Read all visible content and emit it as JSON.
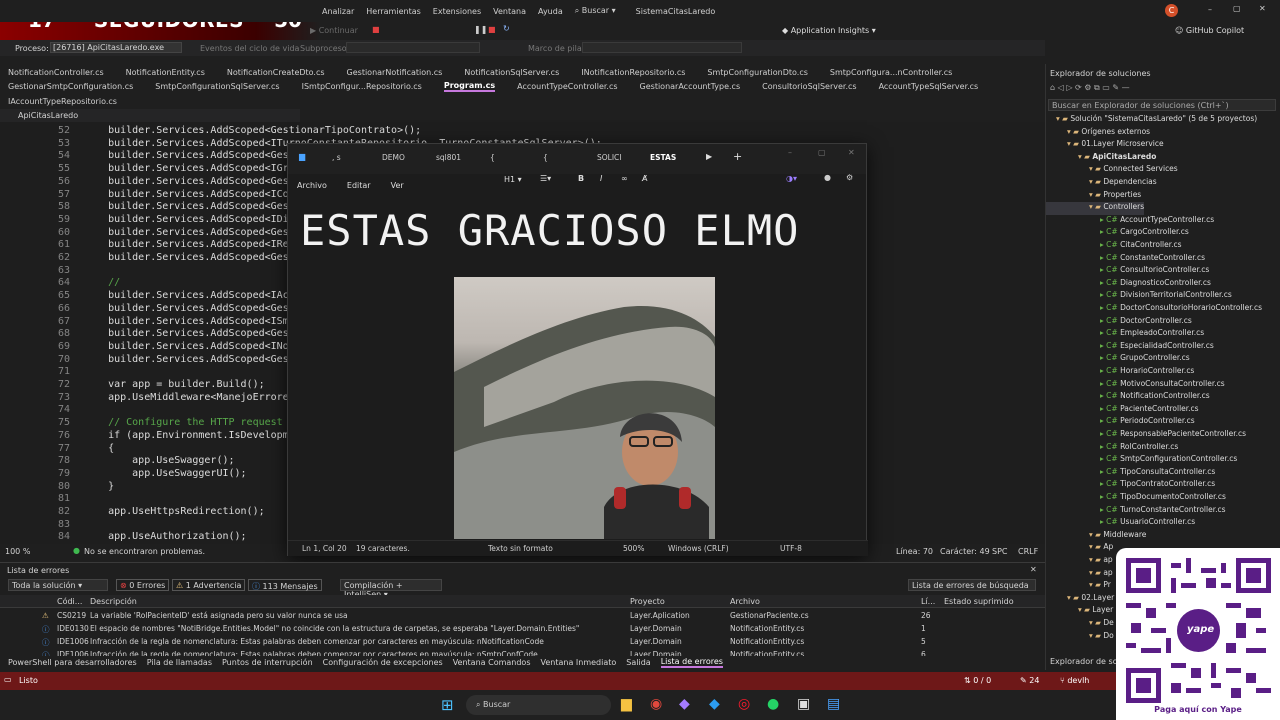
{
  "stream": {
    "count_left": "17",
    "label": "SEGUIDORES",
    "count_right": "50"
  },
  "menubar": {
    "items": [
      "Analizar",
      "Herramientas",
      "Extensiones",
      "Ventana",
      "Ayuda"
    ],
    "search": "Buscar",
    "solution_title": "SistemaCitasLaredo",
    "account_initial": "C"
  },
  "toolbar": {
    "continue": "Continuar",
    "app_insights": "Application Insights",
    "copilot": "GitHub Copilot"
  },
  "process_bar": {
    "label": "Proceso:",
    "process": "[26716] ApiCitasLaredo.exe",
    "lifecycle": "Eventos del ciclo de vida",
    "subprocess": "Subproceso:",
    "stack": "Marco de pila:"
  },
  "doc_tabs_row1": [
    "NotificationController.cs",
    "NotificationEntity.cs",
    "NotificationCreateDto.cs",
    "GestionarNotification.cs",
    "NotificationSqlServer.cs",
    "INotificationRepositorio.cs",
    "SmtpConfigurationDto.cs",
    "SmtpConfigura...nController.cs"
  ],
  "doc_tabs_row2": [
    "GestionarSmtpConfiguration.cs",
    "SmtpConfigurationSqlServer.cs",
    "ISmtpConfigur...Repositorio.cs",
    "Program.cs",
    "AccountTypeController.cs",
    "GestionarAccountType.cs",
    "ConsultorioSqlServer.cs",
    "AccountTypeSqlServer.cs"
  ],
  "doc_tabs_row3": [
    "IAccountTypeRepositorio.cs"
  ],
  "editor": {
    "project_dropdown": "ApiCitasLaredo",
    "lines": [
      {
        "n": "52",
        "t": "    builder.Services.AddScoped<GestionarTipoContrato>();"
      },
      {
        "n": "53",
        "t": "    builder.Services.AddScoped<ITurnoConstanteRepositorio, TurnoConstanteSqlServer>();"
      },
      {
        "n": "54",
        "t": "    builder.Services.AddScoped<Gesti"
      },
      {
        "n": "55",
        "t": "    builder.Services.AddScoped<IGrup"
      },
      {
        "n": "56",
        "t": "    builder.Services.AddScoped<Gesti"
      },
      {
        "n": "57",
        "t": "    builder.Services.AddScoped<ICons"
      },
      {
        "n": "58",
        "t": "    builder.Services.AddScoped<Gesti"
      },
      {
        "n": "59",
        "t": "    builder.Services.AddScoped<IDivi"
      },
      {
        "n": "60",
        "t": "    builder.Services.AddScoped<Gesti"
      },
      {
        "n": "61",
        "t": "    builder.Services.AddScoped<IResp"
      },
      {
        "n": "62",
        "t": "    builder.Services.AddScoped<Gesti"
      },
      {
        "n": "63",
        "t": ""
      },
      {
        "n": "64",
        "t": "    //"
      },
      {
        "n": "65",
        "t": "    builder.Services.AddScoped<IAcco"
      },
      {
        "n": "66",
        "t": "    builder.Services.AddScoped<Gesti"
      },
      {
        "n": "67",
        "t": "    builder.Services.AddScoped<ISmtp"
      },
      {
        "n": "68",
        "t": "    builder.Services.AddScoped<Gesti"
      },
      {
        "n": "69",
        "t": "    builder.Services.AddScoped<INoti"
      },
      {
        "n": "70",
        "t": "    builder.Services.AddScoped<Gesti"
      },
      {
        "n": "71",
        "t": ""
      },
      {
        "n": "72",
        "t": "    var app = builder.Build();"
      },
      {
        "n": "73",
        "t": "    app.UseMiddleware<ManejoErrores>"
      },
      {
        "n": "74",
        "t": ""
      },
      {
        "n": "75",
        "t": "    // Configure the HTTP request pi"
      },
      {
        "n": "76",
        "t": "    if (app.Environment.IsDevelopme"
      },
      {
        "n": "77",
        "t": "    {"
      },
      {
        "n": "78",
        "t": "        app.UseSwagger();"
      },
      {
        "n": "79",
        "t": "        app.UseSwaggerUI();"
      },
      {
        "n": "80",
        "t": "    }"
      },
      {
        "n": "81",
        "t": ""
      },
      {
        "n": "82",
        "t": "    app.UseHttpsRedirection();"
      },
      {
        "n": "83",
        "t": ""
      },
      {
        "n": "84",
        "t": "    app.UseAuthorization();"
      }
    ],
    "zoom": "100 %",
    "no_problems": "No se encontraron problemas.",
    "line": "Línea: 70",
    "char": "Carácter: 49",
    "spc": "SPC",
    "crlf": "CRLF"
  },
  "notepad": {
    "tabs": [
      ", s",
      "DEMO",
      "sql801",
      "{",
      "{",
      "SOLICI",
      "ESTAS"
    ],
    "menu": [
      "Archivo",
      "Editar",
      "Ver"
    ],
    "heading": "H1",
    "content": "ESTAS GRACIOSO ELMO",
    "status": {
      "pos": "Ln 1, Col 20",
      "chars": "19 caracteres.",
      "format": "Texto sin formato",
      "zoom": "500%",
      "eol": "Windows (CRLF)",
      "enc": "UTF-8"
    }
  },
  "solution_explorer": {
    "title": "Explorador de soluciones",
    "search": "Buscar en Explorador de soluciones (Ctrl+`)",
    "items": [
      {
        "d": 0,
        "t": "Solución \"SistemaCitasLaredo\" (5 de 5 proyectos)"
      },
      {
        "d": 1,
        "t": "Orígenes externos"
      },
      {
        "d": 1,
        "t": "01.Layer Microservice"
      },
      {
        "d": 2,
        "t": "ApiCitasLaredo"
      },
      {
        "d": 3,
        "t": "Connected Services"
      },
      {
        "d": 3,
        "t": "Dependencias"
      },
      {
        "d": 3,
        "t": "Properties"
      },
      {
        "d": 3,
        "t": "Controllers"
      },
      {
        "d": 4,
        "t": "AccountTypeController.cs"
      },
      {
        "d": 4,
        "t": "CargoController.cs"
      },
      {
        "d": 4,
        "t": "CitaController.cs"
      },
      {
        "d": 4,
        "t": "ConstanteController.cs"
      },
      {
        "d": 4,
        "t": "ConsultorioController.cs"
      },
      {
        "d": 4,
        "t": "DiagnosticoController.cs"
      },
      {
        "d": 4,
        "t": "DivisionTerritorialController.cs"
      },
      {
        "d": 4,
        "t": "DoctorConsultorioHorarioController.cs"
      },
      {
        "d": 4,
        "t": "DoctorController.cs"
      },
      {
        "d": 4,
        "t": "EmpleadoController.cs"
      },
      {
        "d": 4,
        "t": "EspecialidadController.cs"
      },
      {
        "d": 4,
        "t": "GrupoController.cs"
      },
      {
        "d": 4,
        "t": "HorarioController.cs"
      },
      {
        "d": 4,
        "t": "MotivoConsultaController.cs"
      },
      {
        "d": 4,
        "t": "NotificationController.cs"
      },
      {
        "d": 4,
        "t": "PacienteController.cs"
      },
      {
        "d": 4,
        "t": "PeriodoController.cs"
      },
      {
        "d": 4,
        "t": "ResponsablePacienteController.cs"
      },
      {
        "d": 4,
        "t": "RolController.cs"
      },
      {
        "d": 4,
        "t": "SmtpConfigurationController.cs"
      },
      {
        "d": 4,
        "t": "TipoConsultaController.cs"
      },
      {
        "d": 4,
        "t": "TipoContratoController.cs"
      },
      {
        "d": 4,
        "t": "TipoDocumentoController.cs"
      },
      {
        "d": 4,
        "t": "TurnoConstanteController.cs"
      },
      {
        "d": 4,
        "t": "UsuarioController.cs"
      },
      {
        "d": 3,
        "t": "Middleware"
      },
      {
        "d": 3,
        "t": "Ap"
      },
      {
        "d": 3,
        "t": "ap"
      },
      {
        "d": 3,
        "t": "ap"
      },
      {
        "d": 3,
        "t": "Pr"
      },
      {
        "d": 1,
        "t": "02.Layer"
      },
      {
        "d": 2,
        "t": "Layer"
      },
      {
        "d": 3,
        "t": "De"
      },
      {
        "d": 3,
        "t": "Do"
      }
    ],
    "footer": "Explorador de soluci"
  },
  "errors": {
    "title": "Lista de errores",
    "scope": "Toda la solución",
    "errors": "0 Errores",
    "warnings": "1 Advertencia",
    "messages": "113 Mensajes",
    "build": "Compilación + IntelliSen",
    "search": "Lista de errores de búsqueda",
    "cols": [
      "Códi...",
      "Descripción",
      "Proyecto",
      "Archivo",
      "Lí...",
      "Estado suprimido"
    ],
    "rows": [
      {
        "code": "CS0219",
        "desc": "La variable 'RolPacienteID' está asignada pero su valor nunca se usa",
        "proj": "Layer.Aplication",
        "file": "GestionarPaciente.cs",
        "line": "26"
      },
      {
        "code": "IDE0130",
        "desc": "El espacio de nombres \"NotiBridge.Entities.Model\" no coincide con la estructura de carpetas, se esperaba \"Layer.Domain.Entities\"",
        "proj": "Layer.Domain",
        "file": "NotificationEntity.cs",
        "line": "1"
      },
      {
        "code": "IDE1006",
        "desc": "Infracción de la regla de nomenclatura: Estas palabras deben comenzar por caracteres en mayúscula: nNotificationCode",
        "proj": "Layer.Domain",
        "file": "NotificationEntity.cs",
        "line": "5"
      },
      {
        "code": "IDE1006",
        "desc": "Infracción de la regla de nomenclatura: Estas palabras deben comenzar por caracteres en mayúscula: nSmtpConfCode",
        "proj": "Layer.Domain",
        "file": "NotificationEntity.cs",
        "line": "6"
      }
    ]
  },
  "bottom_tabs": [
    "PowerShell para desarrolladores",
    "Pila de llamadas",
    "Puntos de interrupción",
    "Configuración de excepciones",
    "Ventana Comandos",
    "Ventana Inmediato",
    "Salida",
    "Lista de errores"
  ],
  "statusbar": {
    "ready": "Listo",
    "git_changes": "0 / 0",
    "commits": "24",
    "branch": "devlh"
  },
  "taskbar": {
    "search": "Buscar"
  },
  "qr": {
    "brand": "yape",
    "cta": "Paga aquí con Yape"
  }
}
